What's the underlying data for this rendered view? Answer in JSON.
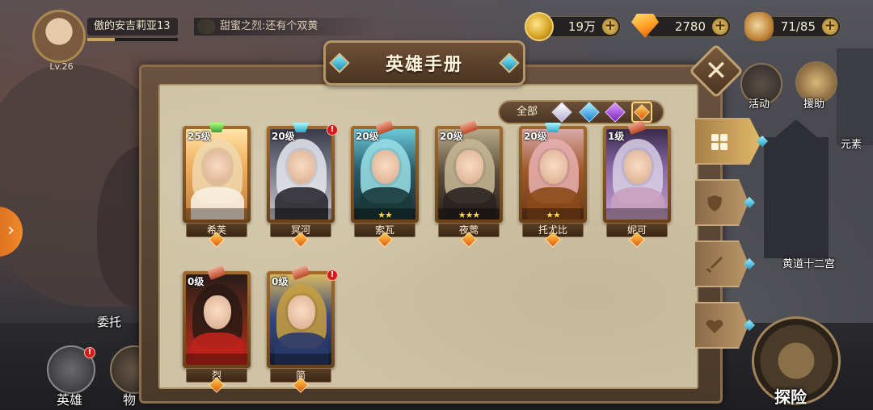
{
  "player": {
    "name": "傲的安吉莉亚13",
    "level": "Lv.26",
    "chat_message": "甜蜜之烈:还有个双黄"
  },
  "resources": {
    "gold": "19万",
    "diamonds": "2780",
    "stamina": "71/85"
  },
  "side_menu": {
    "activity": "活动",
    "support": "援助",
    "element": "元素",
    "zodiac": "黄道十二宫",
    "commission": "委托"
  },
  "bottom_nav": {
    "hero": "英雄",
    "item": "物",
    "explore": "探险"
  },
  "panel": {
    "title": "英雄手册",
    "filter_all": "全部",
    "filters": [
      "white-gem-icon",
      "blue-gem-icon",
      "purple-gem-icon",
      "orange-gem-icon"
    ],
    "active_filter": "orange-gem-icon"
  },
  "heroes": [
    {
      "name": "希芙",
      "level": "25级",
      "stars": "",
      "badge": "green",
      "alert": false
    },
    {
      "name": "冥河",
      "level": "20级",
      "stars": "",
      "badge": "cyan",
      "alert": true
    },
    {
      "name": "索瓦",
      "level": "20级",
      "stars": "★★",
      "badge": "pin",
      "alert": false
    },
    {
      "name": "夜莺",
      "level": "20级",
      "stars": "★★★",
      "badge": "pin",
      "alert": false
    },
    {
      "name": "托尤比",
      "level": "20级",
      "stars": "★★",
      "badge": "cyan",
      "alert": false
    },
    {
      "name": "妮可",
      "level": "1级",
      "stars": "",
      "badge": "pin",
      "alert": false
    },
    {
      "name": "烈",
      "level": "0级",
      "stars": "",
      "badge": "pin",
      "alert": false
    },
    {
      "name": "简",
      "level": "0级",
      "stars": "",
      "badge": "pin",
      "alert": true
    }
  ],
  "alert_mark": "!",
  "close_mark": "✕",
  "plus_mark": "+",
  "colors": {
    "panel_bg": "#cfc2a4",
    "frame": "#6a5240",
    "card_frame": "#a06a2c",
    "alert_red": "#d21c1c",
    "accent_gold": "#e8c46a"
  }
}
